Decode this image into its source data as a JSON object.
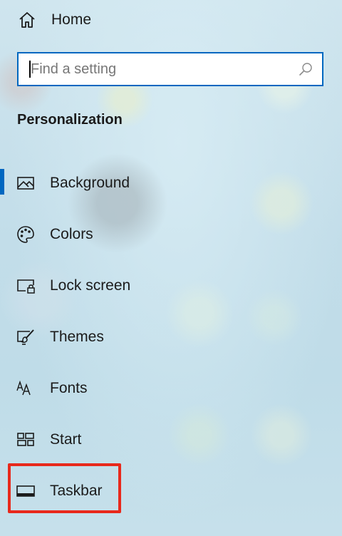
{
  "home": {
    "label": "Home",
    "icon": "home-icon"
  },
  "search": {
    "placeholder": "Find a setting",
    "value": "",
    "icon": "search-icon"
  },
  "section": {
    "title": "Personalization"
  },
  "nav": {
    "items": [
      {
        "label": "Background",
        "icon": "picture-icon",
        "selected": true
      },
      {
        "label": "Colors",
        "icon": "palette-icon",
        "selected": false
      },
      {
        "label": "Lock screen",
        "icon": "lock-screen-icon",
        "selected": false
      },
      {
        "label": "Themes",
        "icon": "brush-icon",
        "selected": false
      },
      {
        "label": "Fonts",
        "icon": "fonts-icon",
        "selected": false
      },
      {
        "label": "Start",
        "icon": "start-grid-icon",
        "selected": false
      },
      {
        "label": "Taskbar",
        "icon": "taskbar-icon",
        "selected": false
      }
    ]
  },
  "colors": {
    "accent": "#0067c0",
    "highlight_outline": "#e8291c"
  }
}
